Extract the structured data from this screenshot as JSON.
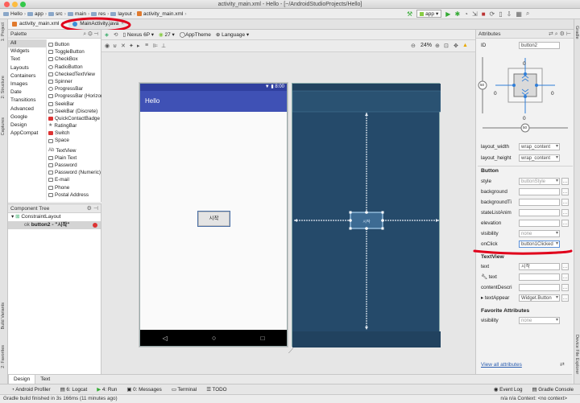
{
  "window": {
    "title": "activity_main.xml - Hello - [~/AndroidStudioProjects/Hello]",
    "breadcrumbs": [
      "Hello",
      "app",
      "src",
      "main",
      "res",
      "layout",
      "activity_main.xml"
    ],
    "run_config": "app"
  },
  "editor_tabs": [
    {
      "label": "activity_main.xml",
      "active": true
    },
    {
      "label": "MainActivity.java",
      "active": false
    }
  ],
  "left_strip": [
    "1: Project",
    "2: Structure",
    "Captures",
    "Build Variants",
    "2: Favorites"
  ],
  "right_strip": [
    "Gradle",
    "Device File Explorer"
  ],
  "palette": {
    "title": "Palette",
    "categories": [
      "All",
      "Widgets",
      "Text",
      "Layouts",
      "Containers",
      "Images",
      "Date",
      "Transitions",
      "Advanced",
      "Google",
      "Design",
      "AppCompat"
    ],
    "selected_category": "All",
    "items": [
      "Button",
      "ToggleButton",
      "CheckBox",
      "RadioButton",
      "CheckedTextView",
      "Spinner",
      "ProgressBar",
      "ProgressBar (Horizontal)",
      "SeekBar",
      "SeekBar (Discrete)",
      "QuickContactBadge",
      "RatingBar",
      "Switch",
      "Space",
      "TextView",
      "Plain Text",
      "Password",
      "Password (Numeric)",
      "E-mail",
      "Phone",
      "Postal Address"
    ]
  },
  "component_tree": {
    "title": "Component Tree",
    "root": "ConstraintLayout",
    "child": "button2 - \"시작\""
  },
  "design_toolbar": {
    "device": "Nexus 6P",
    "api": "27",
    "theme": "AppTheme",
    "language": "Language",
    "zoom": "24%"
  },
  "phone": {
    "time": "8:00",
    "app_title": "Hello",
    "button_text": "시작"
  },
  "bottom_tabs": [
    "Design",
    "Text"
  ],
  "tool_windows": [
    "Android Profiler",
    "6: Logcat",
    "4: Run",
    "0: Messages",
    "Terminal",
    "TODO",
    "Event Log",
    "Gradle Console"
  ],
  "status": {
    "message": "Gradle build finished in 3s 166ms (11 minutes ago)",
    "right": "n/a  n/a  Context: <no context>"
  },
  "attributes": {
    "title": "Attributes",
    "id_label": "ID",
    "id_value": "button2",
    "constraint_margins": {
      "top": "0",
      "bottom": "0",
      "left": "0",
      "right": "0",
      "bias_vertical": "50",
      "bias_horizontal": "50"
    },
    "layout_width_label": "layout_width",
    "layout_width": "wrap_content",
    "layout_height_label": "layout_height",
    "layout_height": "wrap_content",
    "section_button": "Button",
    "style_label": "style",
    "style": "buttonStyle",
    "background_label": "background",
    "backgroundTint_label": "backgroundTi",
    "stateListAnim_label": "stateListAnim",
    "elevation_label": "elevation",
    "visibility_label": "visibility",
    "visibility": "none",
    "onClick_label": "onClick",
    "onClick": "button1Clicked",
    "section_textview": "TextView",
    "text_label": "text",
    "text": "시작",
    "tools_text_label": "text",
    "contentDesc_label": "contentDescri",
    "textAppearance_label": "textAppear",
    "textAppearance": "Widget.Button",
    "section_favorite": "Favorite Attributes",
    "fav_visibility_label": "visibility",
    "fav_visibility": "none",
    "view_all": "View all attributes"
  },
  "annotation_color": "#e0001b"
}
